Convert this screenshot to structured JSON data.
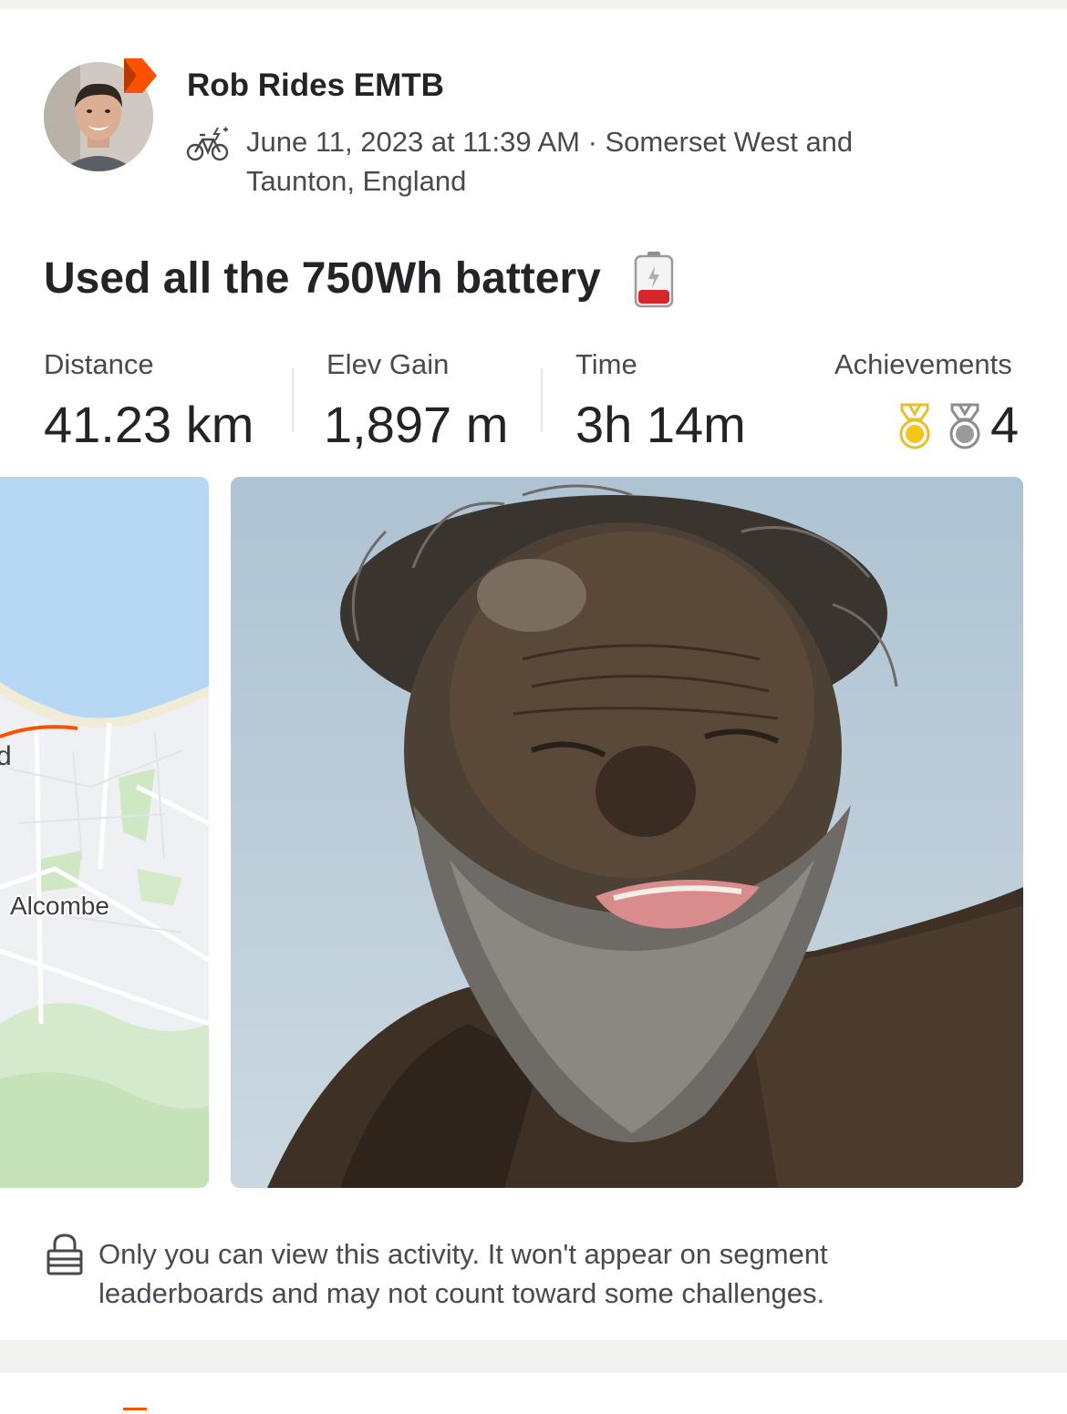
{
  "post": {
    "author": "Rob Rides EMTB",
    "meta_line": "June 11, 2023 at 11:39 AM · Somerset West and Taunton, England",
    "title": "Used all the 750Wh battery",
    "activity_icon": "ebike-icon",
    "title_icon": "low-battery-icon"
  },
  "stats": {
    "distance": {
      "label": "Distance",
      "value": "41.23 km"
    },
    "elev_gain": {
      "label": "Elev Gain",
      "value": "1,897 m"
    },
    "time": {
      "label": "Time",
      "value": "3h 14m"
    },
    "achievements": {
      "label": "Achievements",
      "count": "4",
      "icons": [
        "gold-medal-icon",
        "silver-medal-icon"
      ]
    }
  },
  "map": {
    "place_labels": [
      "d",
      "Alcombe"
    ]
  },
  "privacy_notice": "Only you can view this activity. It won't appear on segment leaderboards and may not count toward some challenges.",
  "colors": {
    "brand_orange": "#fc5200",
    "text_primary": "#242428",
    "text_secondary": "#494950",
    "gold": "#f5c518",
    "silver": "#9a9a9a"
  }
}
